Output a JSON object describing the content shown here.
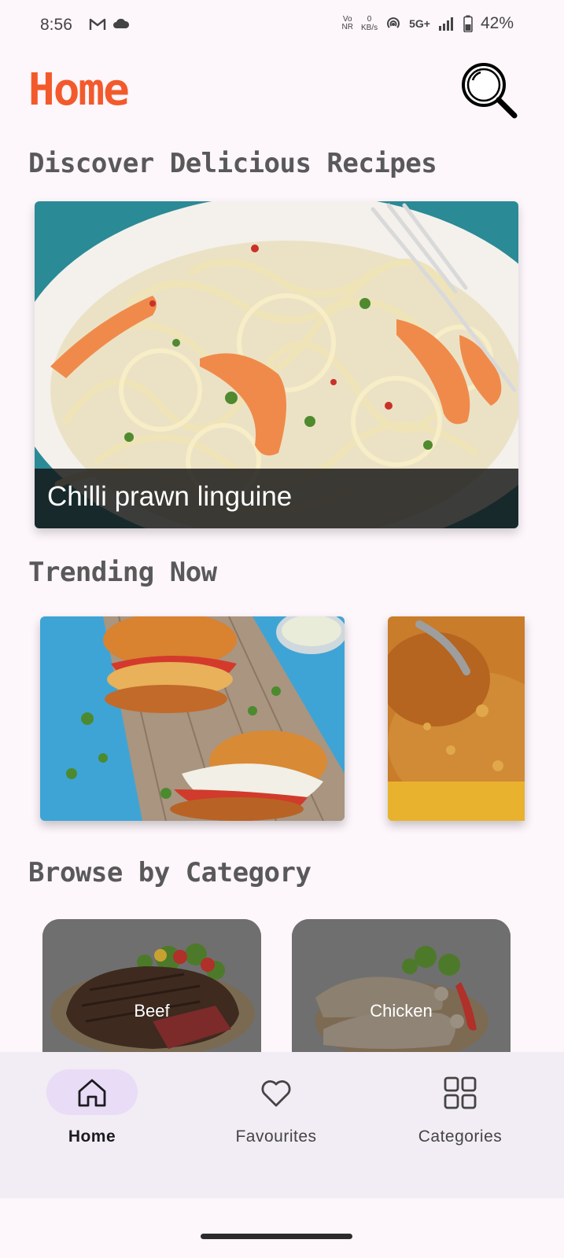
{
  "status_bar": {
    "time": "8:56",
    "vo_label": "Vo",
    "nr_label": "NR",
    "speed_value": "0",
    "speed_unit": "KB/s",
    "network": "5G+",
    "battery": "42%"
  },
  "header": {
    "title": "Home"
  },
  "sections": {
    "discover": "Discover Delicious Recipes",
    "trending": "Trending Now",
    "browse": "Browse by Category"
  },
  "featured": {
    "title": "Chilli prawn linguine"
  },
  "categories": [
    {
      "label": "Beef"
    },
    {
      "label": "Chicken"
    }
  ],
  "bottom_nav": {
    "items": [
      {
        "label": "Home",
        "icon": "home-icon",
        "active": true
      },
      {
        "label": "Favourites",
        "icon": "heart-icon",
        "active": false
      },
      {
        "label": "Categories",
        "icon": "grid-icon",
        "active": false
      }
    ]
  },
  "colors": {
    "accent": "#f25a2c",
    "background": "#fdf6fb",
    "nav_background": "#f2ecf4",
    "active_pill": "#e9dcf6"
  }
}
